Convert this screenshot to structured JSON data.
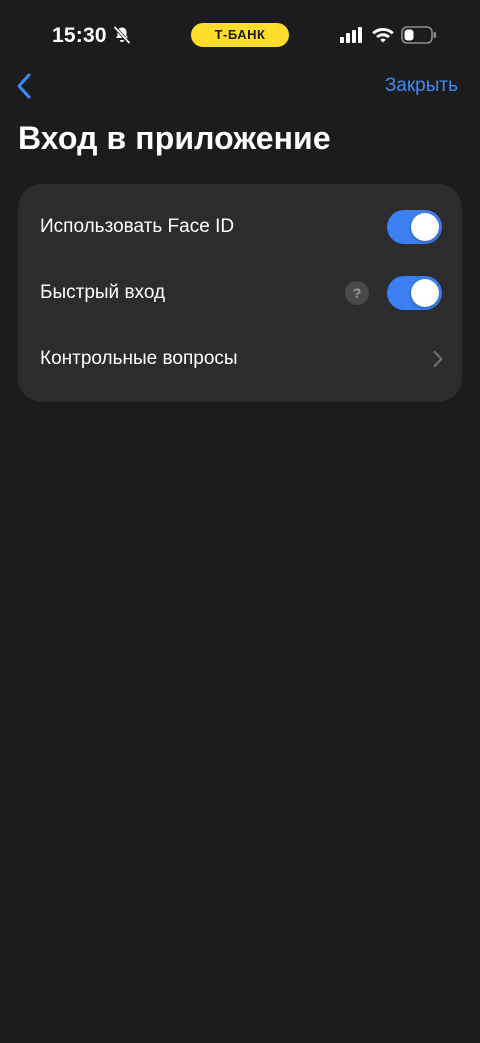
{
  "status_bar": {
    "time": "15:30",
    "carrier": "Т-БАНК",
    "carrier_color": "#ffdd2d",
    "icons": [
      "mute-bell-icon",
      "signal-icon",
      "wifi-icon",
      "battery-icon"
    ]
  },
  "nav": {
    "back_icon": "chevron-left-icon",
    "close_label": "Закрыть"
  },
  "page": {
    "title": "Вход в приложение"
  },
  "settings": {
    "items": [
      {
        "label": "Использовать Face ID",
        "control": "toggle",
        "on": true
      },
      {
        "label": "Быстрый вход",
        "control": "toggle",
        "on": true,
        "help_icon": "?"
      },
      {
        "label": "Контрольные вопросы",
        "control": "chevron"
      }
    ]
  },
  "colors": {
    "background": "#1c1c1e",
    "card": "#2c2c2e",
    "accent": "#3d8bf2",
    "toggle_on": "#3d7ff0"
  }
}
